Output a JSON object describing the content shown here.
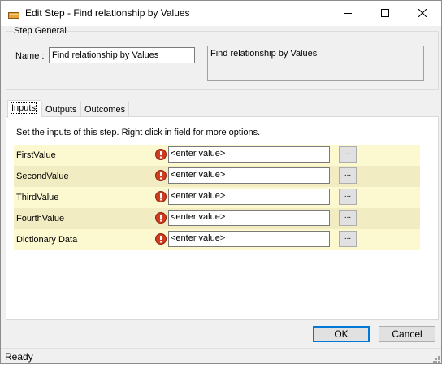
{
  "window": {
    "title": "Edit Step - Find relationship by Values"
  },
  "caption_buttons": {
    "minimize_icon": "minimize-icon",
    "maximize_icon": "maximize-icon",
    "close_icon": "close-icon"
  },
  "step_general": {
    "group_label": "Step General",
    "name_label": "Name :",
    "name_value": "Find relationship by Values",
    "description": "Find relationship by Values"
  },
  "tabs": [
    {
      "label": "Inputs",
      "active": true
    },
    {
      "label": "Outputs",
      "active": false
    },
    {
      "label": "Outcomes",
      "active": false
    }
  ],
  "inputs_panel": {
    "description": "Set the inputs of this step.  Right click in field for more options.",
    "rows": [
      {
        "label": "FirstValue",
        "value": "<enter value>",
        "button": "..."
      },
      {
        "label": "SecondValue",
        "value": "<enter value>",
        "button": "..."
      },
      {
        "label": "ThirdValue",
        "value": "<enter value>",
        "button": "..."
      },
      {
        "label": "FourthValue",
        "value": "<enter value>",
        "button": "..."
      },
      {
        "label": "Dictionary Data",
        "value": "<enter value>",
        "button": "..."
      }
    ]
  },
  "footer": {
    "ok_label": "OK",
    "cancel_label": "Cancel"
  },
  "status": {
    "text": "Ready"
  },
  "colors": {
    "row_odd": "#fcf8d0",
    "row_even": "#f2ecc2",
    "warning": "#d13b1f",
    "accent": "#0078d7"
  }
}
